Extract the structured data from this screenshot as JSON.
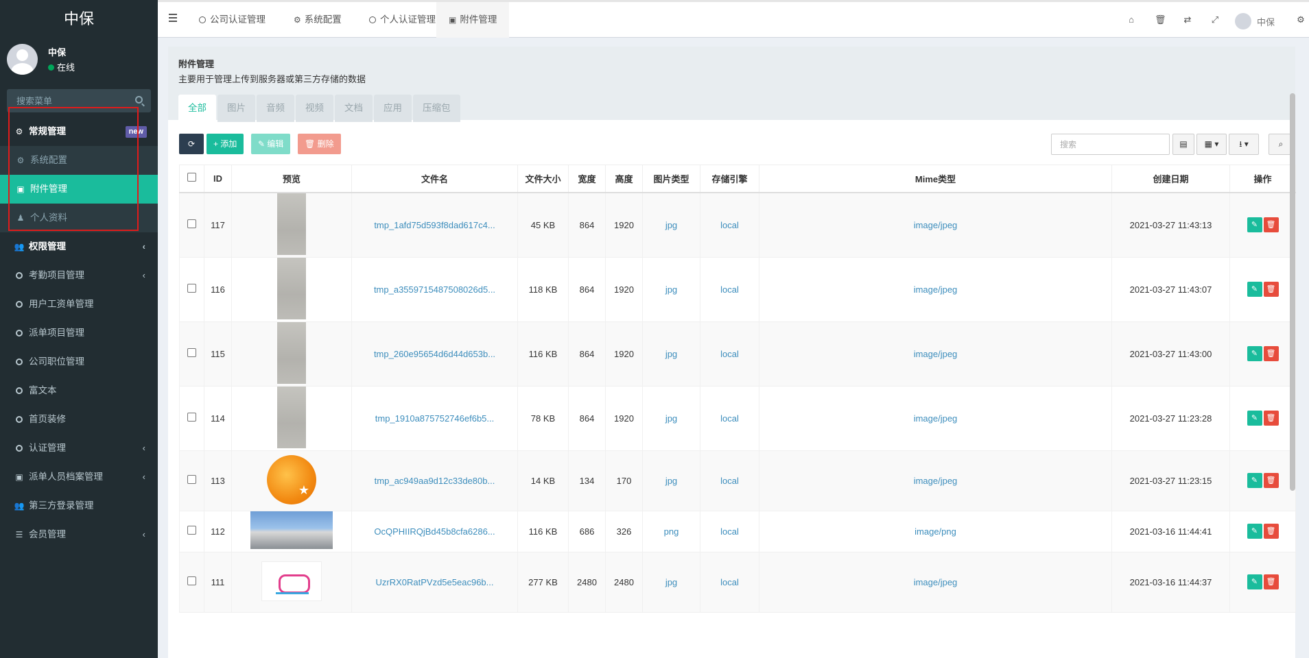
{
  "sidebar": {
    "logo": "中保",
    "user": {
      "name": "中保",
      "status": "在线"
    },
    "search_placeholder": "搜索菜单",
    "items": [
      {
        "label": "常规管理",
        "badge": "new",
        "type": "group-open",
        "icon": "cogs-icon"
      },
      {
        "label": "系统配置",
        "type": "sub",
        "icon": "gear-icon"
      },
      {
        "label": "附件管理",
        "type": "sub-active",
        "icon": "file-image-icon"
      },
      {
        "label": "个人资料",
        "type": "sub",
        "icon": "user-icon"
      },
      {
        "label": "权限管理",
        "type": "group",
        "icon": "group-icon",
        "chevron": true
      },
      {
        "label": "考勤项目管理",
        "type": "item",
        "icon": "circle-icon",
        "chevron": true
      },
      {
        "label": "用户工资单管理",
        "type": "item",
        "icon": "circle-icon"
      },
      {
        "label": "派单项目管理",
        "type": "item",
        "icon": "circle-icon"
      },
      {
        "label": "公司职位管理",
        "type": "item",
        "icon": "circle-icon"
      },
      {
        "label": "富文本",
        "type": "item",
        "icon": "circle-icon"
      },
      {
        "label": "首页装修",
        "type": "item",
        "icon": "circle-icon"
      },
      {
        "label": "认证管理",
        "type": "item",
        "icon": "circle-icon",
        "chevron": true
      },
      {
        "label": "派单人员档案管理",
        "type": "item",
        "icon": "id-card-icon",
        "chevron": true
      },
      {
        "label": "第三方登录管理",
        "type": "item",
        "icon": "users-icon"
      },
      {
        "label": "会员管理",
        "type": "item",
        "icon": "list-icon",
        "chevron": true
      }
    ]
  },
  "topbar": {
    "tabs": [
      {
        "label": "公司认证管理",
        "icon": "circle-icon"
      },
      {
        "label": "系统配置",
        "icon": "gear-icon"
      },
      {
        "label": "个人认证管理",
        "icon": "circle-icon"
      },
      {
        "label": "附件管理",
        "icon": "file-image-icon",
        "active": true
      }
    ],
    "username": "中保"
  },
  "page": {
    "title": "附件管理",
    "description": "主要用于管理上传到服务器或第三方存储的数据",
    "filter_tabs": [
      "全部",
      "图片",
      "音频",
      "视频",
      "文档",
      "应用",
      "压缩包"
    ],
    "buttons": {
      "add": "添加",
      "edit": "编辑",
      "delete": "删除"
    },
    "search_placeholder": "搜索"
  },
  "table": {
    "headers": [
      "ID",
      "预览",
      "文件名",
      "文件大小",
      "宽度",
      "高度",
      "图片类型",
      "存储引擎",
      "Mime类型",
      "创建日期",
      "操作"
    ],
    "rows": [
      {
        "id": "117",
        "preview": "grey",
        "filename": "tmp_1afd75d593f8dad617c4...",
        "size": "45 KB",
        "width": "864",
        "height": "1920",
        "imgtype": "jpg",
        "storage": "local",
        "mime": "image/jpeg",
        "created": "2021-03-27 11:43:13"
      },
      {
        "id": "116",
        "preview": "grey",
        "filename": "tmp_a3559715487508026d5...",
        "size": "118 KB",
        "width": "864",
        "height": "1920",
        "imgtype": "jpg",
        "storage": "local",
        "mime": "image/jpeg",
        "created": "2021-03-27 11:43:07"
      },
      {
        "id": "115",
        "preview": "grey",
        "filename": "tmp_260e95654d6d44d653b...",
        "size": "116 KB",
        "width": "864",
        "height": "1920",
        "imgtype": "jpg",
        "storage": "local",
        "mime": "image/jpeg",
        "created": "2021-03-27 11:43:00"
      },
      {
        "id": "114",
        "preview": "grey",
        "filename": "tmp_1910a875752746ef6b5...",
        "size": "78 KB",
        "width": "864",
        "height": "1920",
        "imgtype": "jpg",
        "storage": "local",
        "mime": "image/jpeg",
        "created": "2021-03-27 11:23:28"
      },
      {
        "id": "113",
        "preview": "logo",
        "filename": "tmp_ac949aa9d12c33de80b...",
        "size": "14 KB",
        "width": "134",
        "height": "170",
        "imgtype": "jpg",
        "storage": "local",
        "mime": "image/jpeg",
        "created": "2021-03-27 11:23:15"
      },
      {
        "id": "112",
        "preview": "photo",
        "filename": "OcQPHIIRQjBd45b8cfa6286...",
        "size": "116 KB",
        "width": "686",
        "height": "326",
        "imgtype": "png",
        "storage": "local",
        "mime": "image/png",
        "created": "2021-03-16 11:44:41"
      },
      {
        "id": "111",
        "preview": "pink",
        "filename": "UzrRX0RatPVzd5e5eac96b...",
        "size": "277 KB",
        "width": "2480",
        "height": "2480",
        "imgtype": "jpg",
        "storage": "local",
        "mime": "image/jpeg",
        "created": "2021-03-16 11:44:37"
      }
    ]
  }
}
